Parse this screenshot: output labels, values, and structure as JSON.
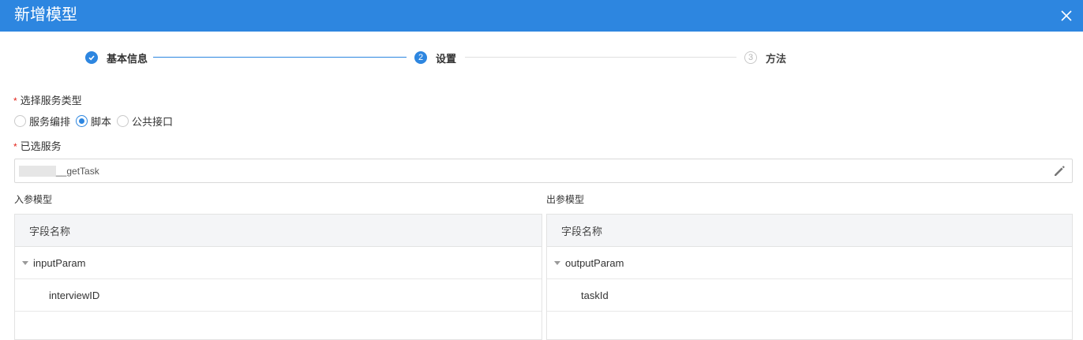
{
  "dialog": {
    "title": "新增模型"
  },
  "steps": [
    {
      "label": "基本信息",
      "number": "",
      "state": "done"
    },
    {
      "label": "设置",
      "number": "2",
      "state": "active"
    },
    {
      "label": "方法",
      "number": "3",
      "state": "todo"
    }
  ],
  "service_type": {
    "label": "选择服务类型",
    "required_mark": "*",
    "options": [
      "服务编排",
      "脚本",
      "公共接口"
    ],
    "selected": "脚本"
  },
  "selected_service": {
    "label": "已选服务",
    "required_mark": "*",
    "value": "__getTask"
  },
  "input_model": {
    "title": "入参模型",
    "column_header": "字段名称",
    "rows": [
      {
        "name": "inputParam",
        "level": 0,
        "expanded": true
      },
      {
        "name": "interviewID",
        "level": 1
      }
    ]
  },
  "output_model": {
    "title": "出参模型",
    "column_header": "字段名称",
    "rows": [
      {
        "name": "outputParam",
        "level": 0,
        "expanded": true
      },
      {
        "name": "taskId",
        "level": 1
      }
    ]
  },
  "colors": {
    "primary": "#2d86e0",
    "required": "#e2231a",
    "header_bg": "#f4f5f7"
  },
  "icons": {
    "close": "close-icon",
    "edit": "pencil-icon",
    "step_done": "check-icon",
    "tree_toggle": "caret-down-icon"
  }
}
